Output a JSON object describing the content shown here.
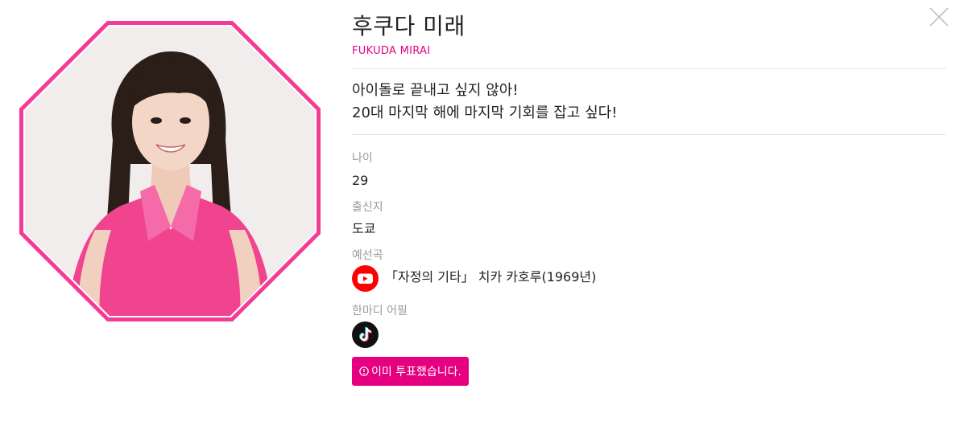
{
  "profile": {
    "name": "후쿠다 미래",
    "name_en": "FUKUDA MIRAI",
    "catchphrase_line1": "아이돌로 끝내고 싶지 않아!",
    "catchphrase_line2": "20대 마지막 해에 마지막 기회를 잡고 싶다!"
  },
  "fields": {
    "age_label": "나이",
    "age_value": "29",
    "origin_label": "출신지",
    "origin_value": "도쿄",
    "song_label": "예선곡",
    "song_value": "「자정의 기타」 치카 카호루(1969년)",
    "appeal_label": "한마디 어필"
  },
  "vote": {
    "label": "이미 투표했습니다."
  },
  "icons": {
    "close": "close-icon",
    "youtube": "youtube-icon",
    "tiktok": "tiktok-icon",
    "info": "info-icon"
  },
  "colors": {
    "accent": "#e4007f",
    "frame": "#f43b96",
    "youtube_red": "#ff0000"
  }
}
